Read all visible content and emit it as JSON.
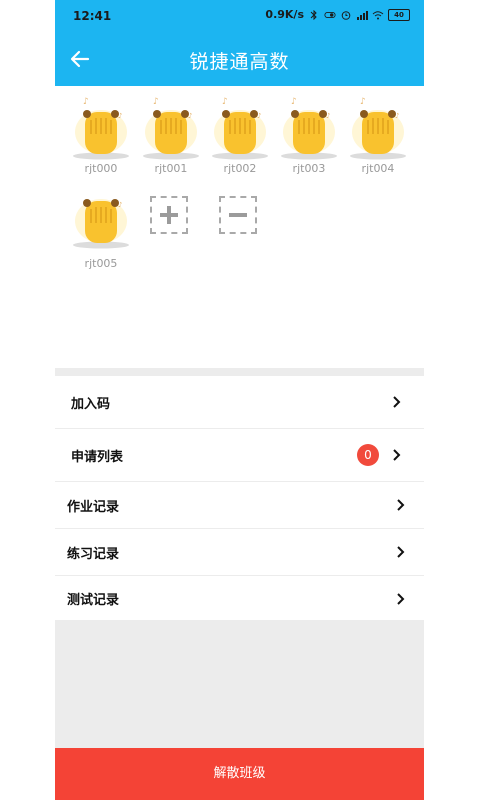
{
  "status": {
    "time": "12:41",
    "network_speed": "0.9K/s",
    "battery": "40"
  },
  "header": {
    "title": "锐捷通高数"
  },
  "members": [
    {
      "name": "rjt000"
    },
    {
      "name": "rjt001"
    },
    {
      "name": "rjt002"
    },
    {
      "name": "rjt003"
    },
    {
      "name": "rjt004"
    },
    {
      "name": "rjt005"
    }
  ],
  "menu": {
    "join_code": "加入码",
    "apply_list": "申请列表",
    "apply_count": "0",
    "homework": "作业记录",
    "practice": "练习记录",
    "test": "测试记录"
  },
  "footer": {
    "dismiss": "解散班级"
  },
  "colors": {
    "accent": "#1cb5f1",
    "danger": "#f44336",
    "badge": "#f14a3c"
  }
}
